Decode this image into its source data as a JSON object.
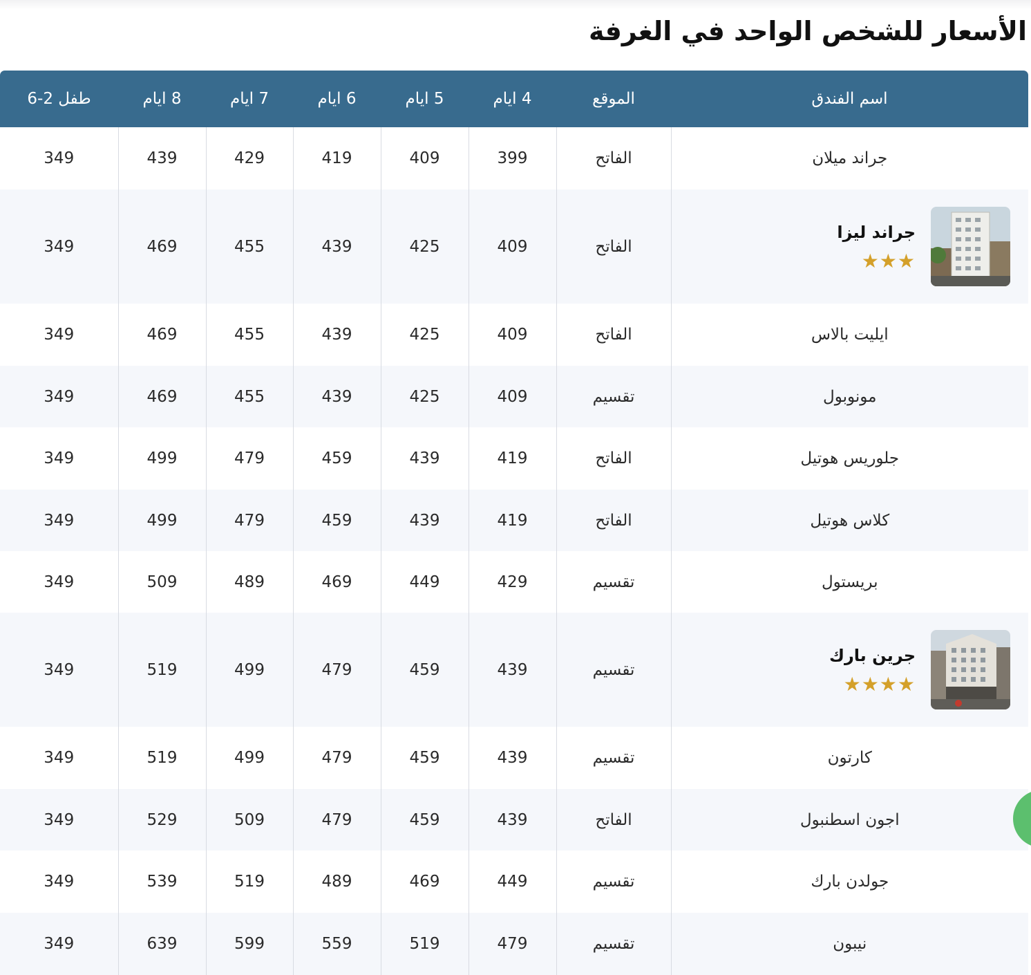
{
  "page": {
    "title": "الأسعار للشخص الواحد في الغرفة"
  },
  "table": {
    "headers": [
      "اسم الفندق",
      "الموقع",
      "4 ايام",
      "5 ايام",
      "6 ايام",
      "7 ايام",
      "8 ايام",
      "طفل 2-6"
    ],
    "rows": [
      {
        "name": "جراند ميلان",
        "location": "الفاتح",
        "prices": [
          "399",
          "409",
          "419",
          "429",
          "439",
          "349"
        ]
      },
      {
        "name": "جراند ليزا",
        "location": "الفاتح",
        "prices": [
          "409",
          "425",
          "439",
          "455",
          "469",
          "349"
        ],
        "stars": "★★★"
      },
      {
        "name": "ايليت بالاس",
        "location": "الفاتح",
        "prices": [
          "409",
          "425",
          "439",
          "455",
          "469",
          "349"
        ]
      },
      {
        "name": "مونوبول",
        "location": "تقسيم",
        "prices": [
          "409",
          "425",
          "439",
          "455",
          "469",
          "349"
        ]
      },
      {
        "name": "جلوريس هوتيل",
        "location": "الفاتح",
        "prices": [
          "419",
          "439",
          "459",
          "479",
          "499",
          "349"
        ]
      },
      {
        "name": "كلاس هوتيل",
        "location": "الفاتح",
        "prices": [
          "419",
          "439",
          "459",
          "479",
          "499",
          "349"
        ]
      },
      {
        "name": "بريستول",
        "location": "تقسيم",
        "prices": [
          "429",
          "449",
          "469",
          "489",
          "509",
          "349"
        ]
      },
      {
        "name": "جرين بارك",
        "location": "تقسيم",
        "prices": [
          "439",
          "459",
          "479",
          "499",
          "519",
          "349"
        ],
        "stars": "★★★★"
      },
      {
        "name": "كارتون",
        "location": "تقسيم",
        "prices": [
          "439",
          "459",
          "479",
          "499",
          "519",
          "349"
        ]
      },
      {
        "name": "اجون اسطنبول",
        "location": "الفاتح",
        "prices": [
          "439",
          "459",
          "479",
          "509",
          "529",
          "349"
        ]
      },
      {
        "name": "جولدن بارك",
        "location": "تقسيم",
        "prices": [
          "449",
          "469",
          "489",
          "519",
          "539",
          "349"
        ]
      },
      {
        "name": "نيبون",
        "location": "تقسيم",
        "prices": [
          "479",
          "519",
          "559",
          "599",
          "639",
          "349"
        ]
      }
    ]
  },
  "colors": {
    "header_bg": "#386b8e",
    "header_text": "#ffffff",
    "row_alt_bg": "#f5f7fb",
    "star": "#d4a02a",
    "floating_button": "#5cbf6e"
  },
  "icons": {
    "star": "star-icon",
    "hotel_photo": "hotel-photo-icon",
    "floating_button": "chat-button"
  }
}
